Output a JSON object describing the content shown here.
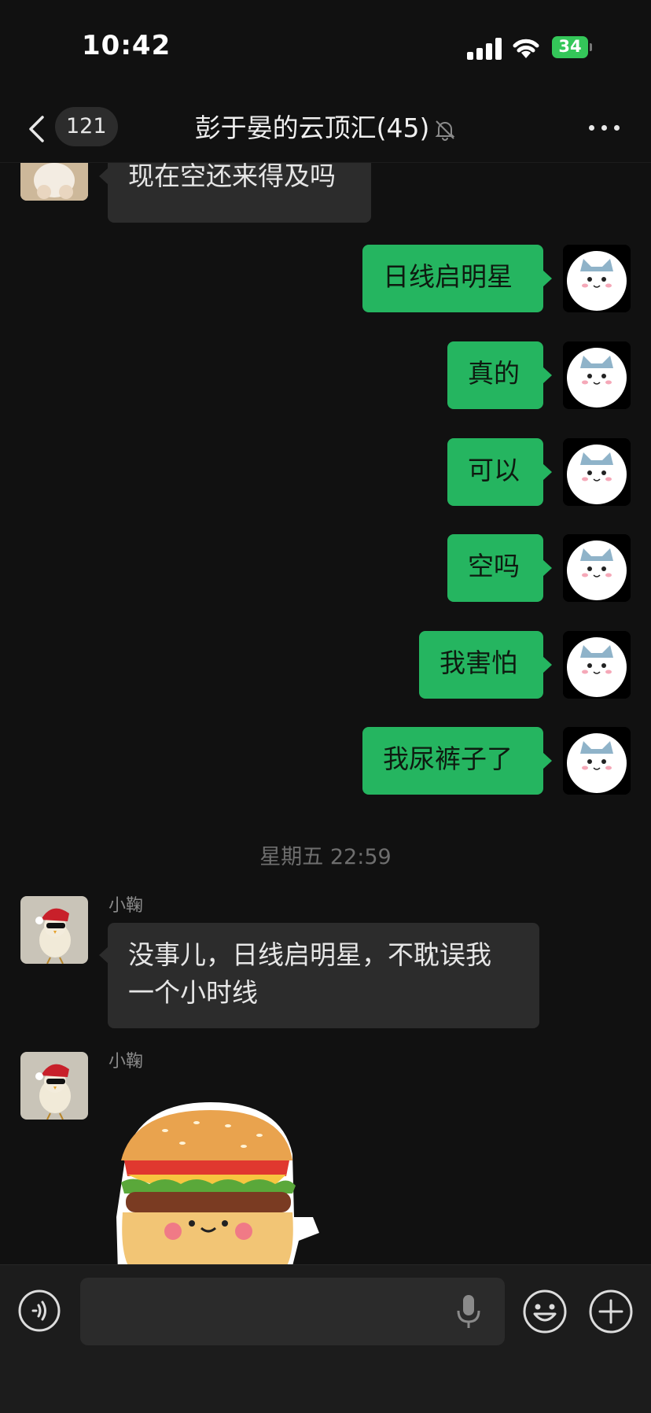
{
  "status_bar": {
    "time": "10:42",
    "battery": "34"
  },
  "nav": {
    "unread_count": "121",
    "title": "彭于晏的云顶汇(45)"
  },
  "messages": {
    "m0": {
      "text": "现在空还来得及吗"
    },
    "m1": {
      "text": "日线启明星"
    },
    "m2": {
      "text": "真的"
    },
    "m3": {
      "text": "可以"
    },
    "m4": {
      "text": "空吗"
    },
    "m5": {
      "text": "我害怕"
    },
    "m6": {
      "text": "我尿裤子了"
    },
    "timestamp": "星期五 22:59",
    "m7": {
      "sender": "小鞠",
      "text_line1": "没事儿，日线启明星，不耽误我",
      "text_line2": "一个小时线"
    },
    "m8": {
      "sender": "小鞠",
      "sticker": "hamburger-sticker"
    }
  },
  "colors": {
    "background": "#111111",
    "outgoing_bubble": "#25b560",
    "incoming_bubble": "#2c2c2c",
    "battery": "#34c759"
  },
  "input_bar": {
    "placeholder": ""
  }
}
